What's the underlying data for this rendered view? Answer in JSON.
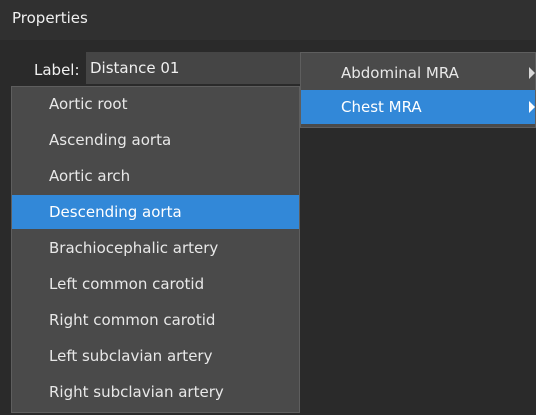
{
  "panel": {
    "title": "Properties"
  },
  "label_field": {
    "caption": "Label:",
    "value": "Distance 01"
  },
  "submenu": {
    "items": [
      {
        "label": "Abdominal MRA",
        "selected": false,
        "icon": "chevron-right-icon"
      },
      {
        "label": "Chest MRA",
        "selected": true,
        "icon": "chevron-right-icon"
      }
    ]
  },
  "menu": {
    "items": [
      {
        "label": "Aortic root",
        "selected": false
      },
      {
        "label": "Ascending aorta",
        "selected": false
      },
      {
        "label": "Aortic arch",
        "selected": false
      },
      {
        "label": "Descending aorta",
        "selected": true
      },
      {
        "label": "Brachiocephalic artery",
        "selected": false
      },
      {
        "label": "Left common carotid",
        "selected": false
      },
      {
        "label": "Right common carotid",
        "selected": false
      },
      {
        "label": "Left subclavian artery",
        "selected": false
      },
      {
        "label": "Right subclavian artery",
        "selected": false
      }
    ]
  },
  "colors": {
    "background": "#2a2a2a",
    "menu_background": "#4a4a4a",
    "selection": "#3288d8"
  }
}
